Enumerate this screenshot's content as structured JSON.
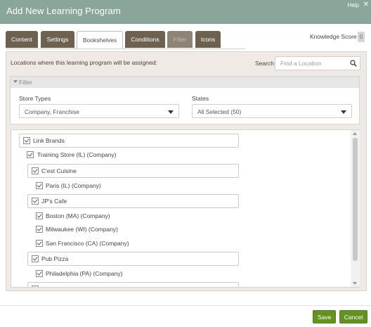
{
  "window": {
    "title": "Add New Learning Program",
    "help": "Help",
    "close": "✕"
  },
  "tabs": [
    {
      "label": "Content",
      "state": "normal"
    },
    {
      "label": "Settings",
      "state": "normal"
    },
    {
      "label": "Bookshelves",
      "state": "active"
    },
    {
      "label": "Conditions",
      "state": "normal"
    },
    {
      "label": "Filter",
      "state": "disabled"
    },
    {
      "label": "Icons",
      "state": "normal"
    }
  ],
  "knowledge_score": {
    "label": "Knowledge Score",
    "value": "0"
  },
  "locations": {
    "description": "Locations where this learning program will be assigned:",
    "search_label": "Search",
    "search_placeholder": "Find a Location",
    "search_icon": "search-icon"
  },
  "filter": {
    "label": "Filter",
    "store_types_label": "Store Types",
    "store_types_value": "Company, Franchise",
    "states_label": "States",
    "states_value": "All Selected (50)"
  },
  "tree": [
    {
      "label": "Link Brands",
      "boxed": true,
      "checked": true
    },
    {
      "label": "Training Store (IL) (Company)",
      "boxed": false,
      "checked": true
    },
    {
      "label": "C'est Cuisine",
      "boxed": true,
      "checked": true
    },
    {
      "label": "Paris (IL) (Company)",
      "boxed": false,
      "checked": true
    },
    {
      "label": "JP's Cafe",
      "boxed": true,
      "checked": true
    },
    {
      "label": "Boston (MA) (Company)",
      "boxed": false,
      "checked": true
    },
    {
      "label": "Milwaukee (WI) (Company)",
      "boxed": false,
      "checked": true
    },
    {
      "label": "San Francisco (CA) (Company)",
      "boxed": false,
      "checked": true
    },
    {
      "label": "Pub Pizza",
      "boxed": true,
      "checked": true
    },
    {
      "label": "Philadelphia (PA) (Company)",
      "boxed": false,
      "checked": true
    }
  ],
  "footer": {
    "save": "Save",
    "cancel": "Cancel"
  },
  "colors": {
    "titlebar": "#8aa69b",
    "tab": "#6f6150",
    "panel": "#efeae6",
    "primary_button": "#62921f"
  }
}
